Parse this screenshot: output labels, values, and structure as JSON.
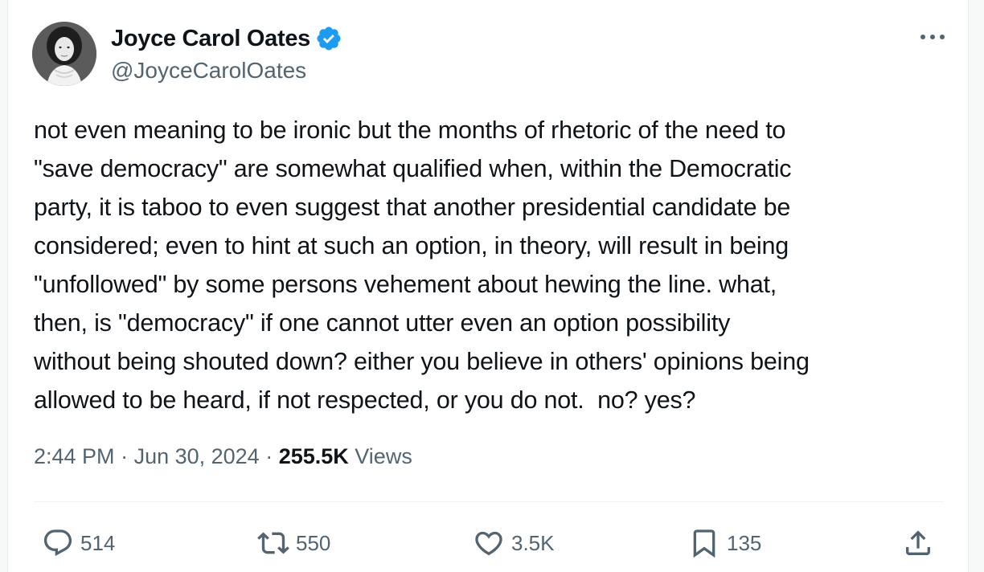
{
  "tweet": {
    "author": {
      "display_name": "Joyce Carol Oates",
      "handle": "@JoyceCarolOates",
      "verified": true
    },
    "text": "not even meaning to be ironic but the months of rhetoric of the need to\n\"save democracy\" are somewhat qualified when, within the Democratic\nparty, it is taboo to even suggest that another presidential candidate be\nconsidered; even to hint at such an option, in theory, will result in being\n\"unfollowed\" by some persons vehement about hewing the line. what,\nthen, is \"democracy\" if one cannot utter even an option possibility\nwithout being shouted down? either you believe in others' opinions being\nallowed to be heard, if not respected, or you do not.  no? yes?",
    "time": "2:44 PM",
    "separator": " · ",
    "date": "Jun 30, 2024",
    "views_count": "255.5K",
    "views_label": " Views",
    "stats": {
      "replies": "514",
      "reposts": "550",
      "likes": "3.5K",
      "bookmarks": "135"
    }
  },
  "icons": {
    "verified": "verified-badge-icon",
    "more": "more-icon",
    "reply": "reply-icon",
    "repost": "repost-icon",
    "like": "like-icon",
    "bookmark": "bookmark-icon",
    "share": "share-icon"
  },
  "colors": {
    "verified": "#1d9bf0",
    "text_primary": "#0f1419",
    "text_secondary": "#536471"
  }
}
